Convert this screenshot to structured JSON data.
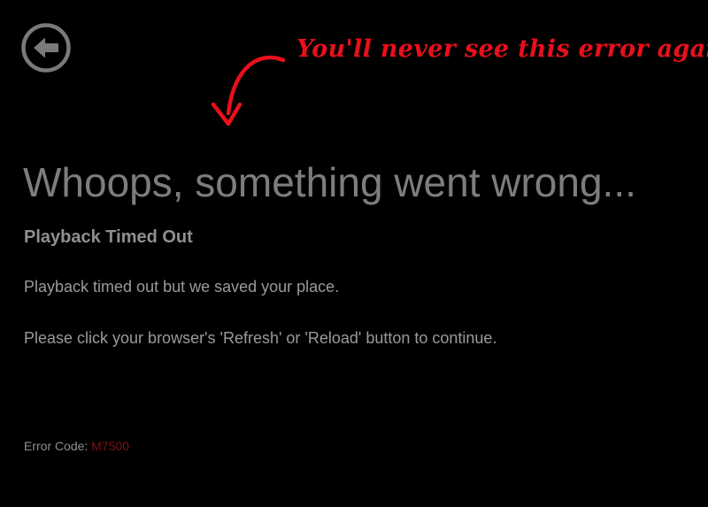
{
  "colors": {
    "background": "#000000",
    "headline": "#7d7d7d",
    "body_text": "#9a9a9a",
    "icon": "#7a7a7a",
    "annotation": "#e8101a",
    "error_code": "#7a1414"
  },
  "back_button": {
    "icon": "arrow-left-circle-icon"
  },
  "annotation": {
    "text": "You'll never see this error again.",
    "arrow_icon": "curved-arrow-down-icon"
  },
  "error": {
    "headline": "Whoops, something went wrong...",
    "subtitle": "Playback Timed Out",
    "message_1": "Playback timed out but we saved your place.",
    "message_2": "Please click your browser's 'Refresh' or 'Reload' button to continue.",
    "code_label": "Error Code:",
    "code_value": "M7500"
  }
}
